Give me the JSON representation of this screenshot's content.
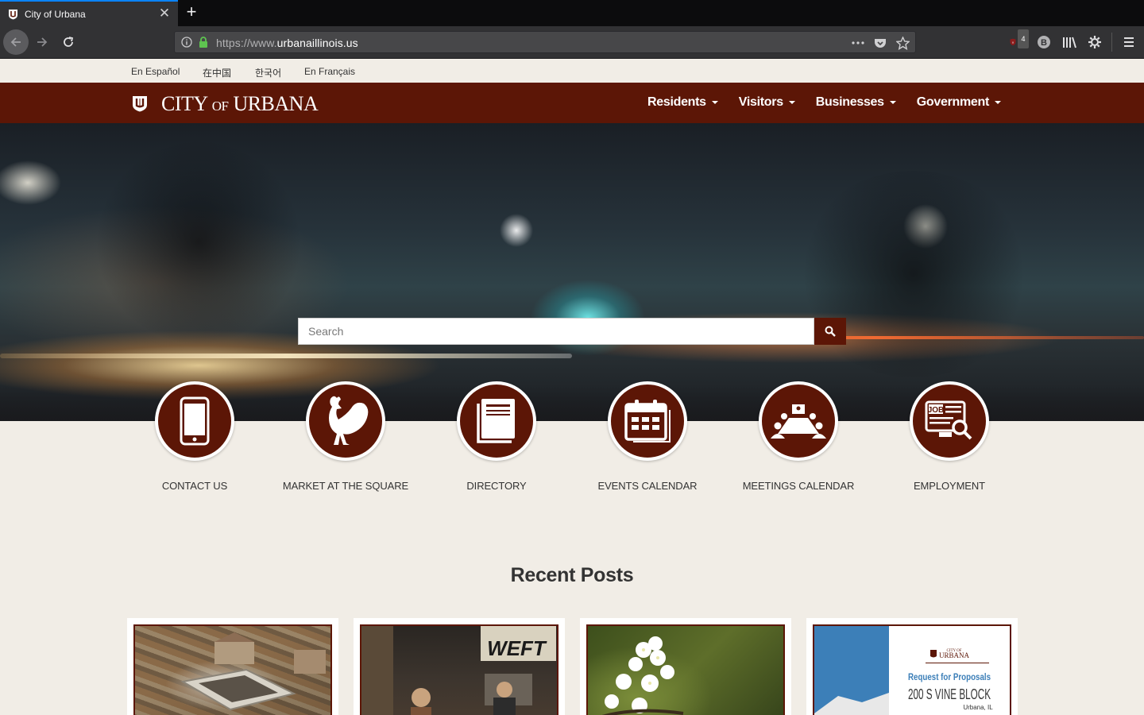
{
  "browser": {
    "tab_title": "City of Urbana",
    "url_prefix": "https://www.",
    "url_domain": "urbanaillinois.us",
    "addon_badge": "4",
    "addon_letter": "B"
  },
  "site": {
    "languages": [
      "En Español",
      "在中国",
      "한국어",
      "En Français"
    ],
    "logo": {
      "main_start": "CITY ",
      "of": "OF",
      "main_end": " URBANA"
    },
    "nav": [
      "Residents",
      "Visitors",
      "Businesses",
      "Government"
    ],
    "search": {
      "placeholder": "Search"
    },
    "quick_links": [
      {
        "label": "CONTACT US",
        "icon": "phone-icon"
      },
      {
        "label": "MARKET AT THE SQUARE",
        "icon": "rooster-icon"
      },
      {
        "label": "DIRECTORY",
        "icon": "book-icon"
      },
      {
        "label": "EVENTS CALENDAR",
        "icon": "calendar-icon"
      },
      {
        "label": "MEETINGS CALENDAR",
        "icon": "meeting-icon"
      },
      {
        "label": "EMPLOYMENT",
        "icon": "job-search-icon"
      }
    ],
    "recent_posts_title": "Recent Posts",
    "posts": [
      {
        "image": "aerial-city-photo"
      },
      {
        "image": "radio-band-photo",
        "sign_text": "WEFT"
      },
      {
        "image": "white-blossoms-photo"
      },
      {
        "image": "rfp-flyer",
        "flyer": {
          "org_top": "CITY OF",
          "org": "URBANA",
          "heading": "Request for Proposals",
          "title": "200 S VINE BLOCK",
          "place": "Urbana, IL"
        }
      }
    ],
    "colors": {
      "brand": "#5c1606",
      "background": "#f1ede6",
      "accent_blue": "#0a84ff"
    }
  }
}
